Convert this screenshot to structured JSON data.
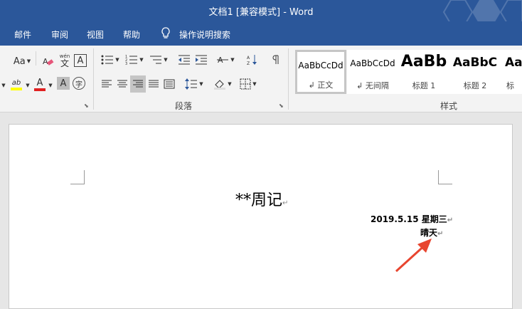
{
  "window": {
    "title": "文档1 [兼容模式]  -  Word"
  },
  "menu": {
    "items": [
      "邮件",
      "审阅",
      "视图",
      "帮助",
      "操作说明搜索"
    ]
  },
  "ribbon": {
    "font_size_btn": "Aa",
    "pinyin_top": "wén",
    "pinyin_char": "文",
    "border_char": "A",
    "highlight_label": "ab",
    "font_color_label": "A",
    "shading_char": "A",
    "enclose_char": "字",
    "groups": {
      "paragraph": "段落",
      "styles": "样式"
    },
    "styles": [
      {
        "sample": "AaBbCcDd",
        "name": "↲ 正文"
      },
      {
        "sample": "AaBbCcDd",
        "name": "↲ 无间隔"
      },
      {
        "sample": "AaBb",
        "name": "标题 1"
      },
      {
        "sample": "AaBbC",
        "name": "标题 2"
      },
      {
        "sample": "Aa",
        "name": "标"
      }
    ]
  },
  "document": {
    "title": "**周记",
    "line1": "2019.5.15  星期三",
    "line2": "晴天",
    "para_mark": "↵"
  },
  "colors": {
    "accent": "#2b579a",
    "arrow": "#e8452f",
    "font_color": "#e02020",
    "highlight": "#ffff00"
  }
}
